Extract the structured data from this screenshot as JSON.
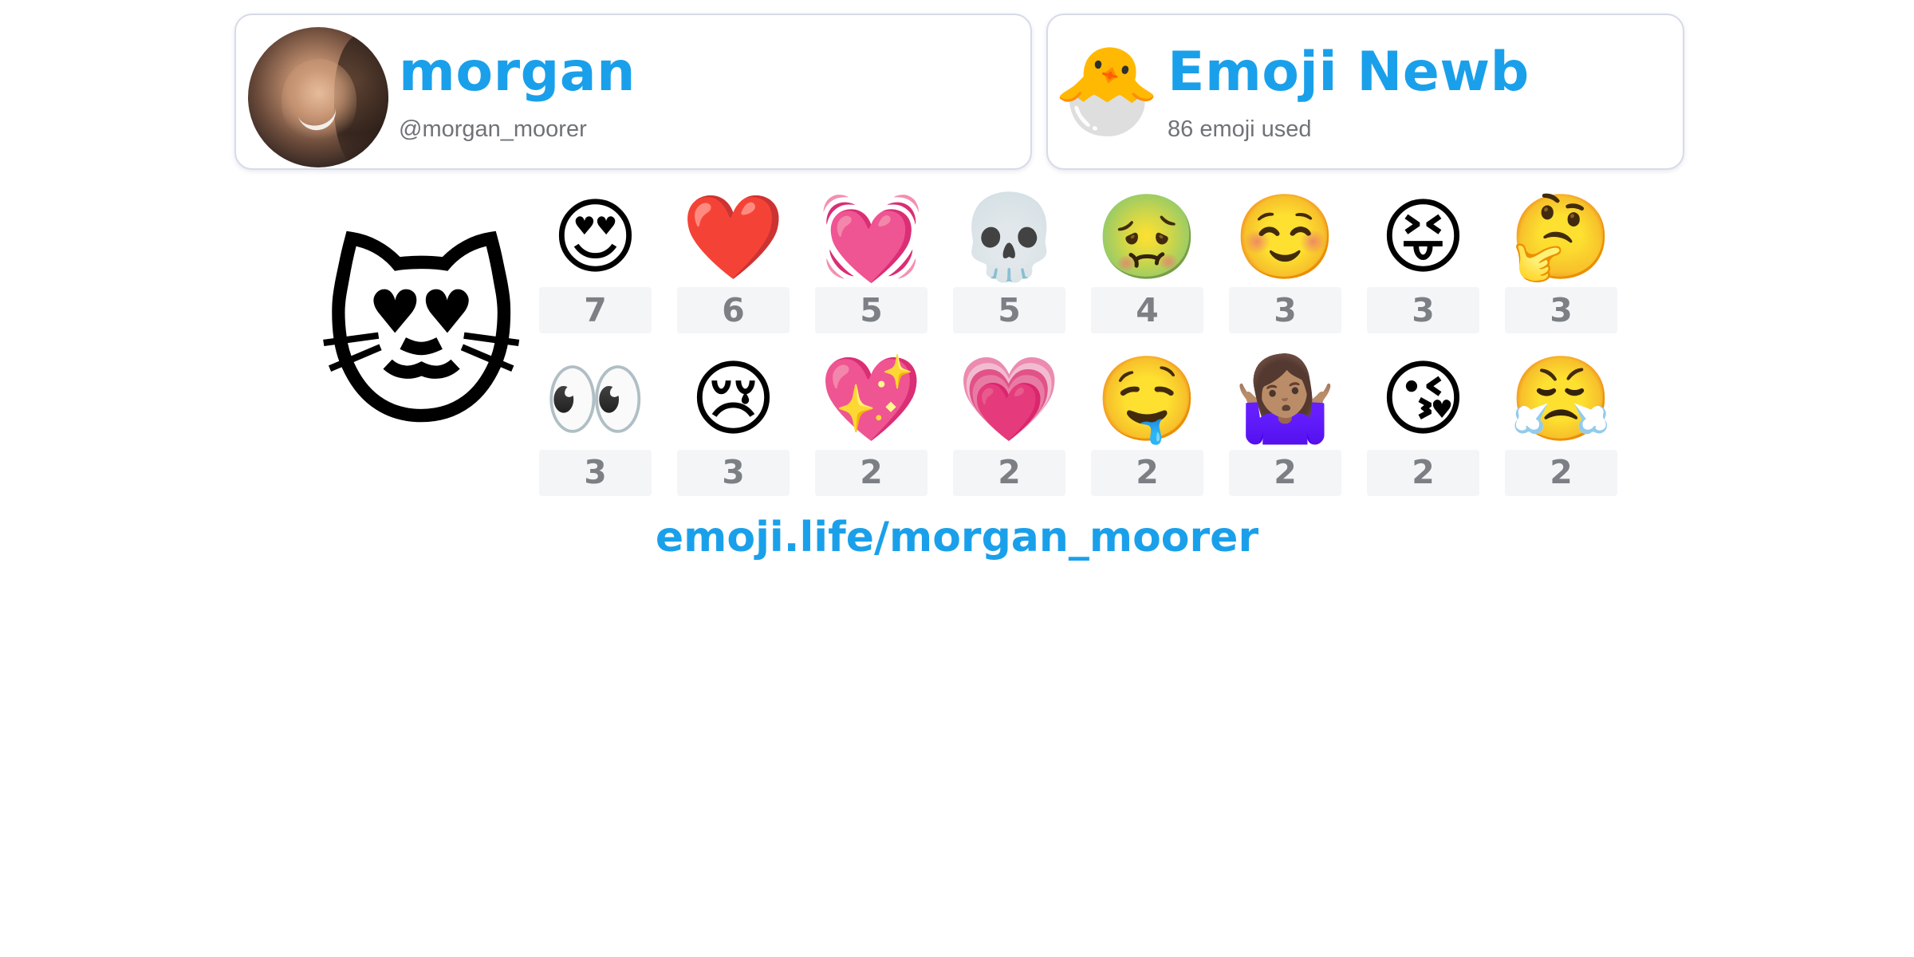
{
  "profile": {
    "name": "morgan",
    "handle": "@morgan_moorer"
  },
  "level": {
    "name": "Emoji Newb",
    "stats": "86 emoji used",
    "icon": "🐣"
  },
  "hero_emoji": "😻",
  "emoji_grid": [
    {
      "emoji": "😍",
      "count": "7",
      "icon_name": "heart-eyes-icon"
    },
    {
      "emoji": "❤️",
      "count": "6",
      "icon_name": "red-heart-icon"
    },
    {
      "emoji": "💓",
      "count": "5",
      "icon_name": "beating-heart-icon"
    },
    {
      "emoji": "💀",
      "count": "5",
      "icon_name": "skull-icon"
    },
    {
      "emoji": "🤢",
      "count": "4",
      "icon_name": "nauseated-face-icon"
    },
    {
      "emoji": "☺️",
      "count": "3",
      "icon_name": "smiling-face-icon"
    },
    {
      "emoji": "😝",
      "count": "3",
      "icon_name": "squinting-tongue-icon"
    },
    {
      "emoji": "🤔",
      "count": "3",
      "icon_name": "thinking-face-icon"
    },
    {
      "emoji": "👀",
      "count": "3",
      "icon_name": "eyes-icon"
    },
    {
      "emoji": "😢",
      "count": "3",
      "icon_name": "crying-face-icon"
    },
    {
      "emoji": "💖",
      "count": "2",
      "icon_name": "sparkling-heart-icon"
    },
    {
      "emoji": "💗",
      "count": "2",
      "icon_name": "growing-heart-icon"
    },
    {
      "emoji": "🤤",
      "count": "2",
      "icon_name": "drooling-face-icon"
    },
    {
      "emoji": "🤷🏽‍♀️",
      "count": "2",
      "icon_name": "shrug-icon"
    },
    {
      "emoji": "😘",
      "count": "2",
      "icon_name": "kiss-face-icon"
    },
    {
      "emoji": "😤",
      "count": "2",
      "icon_name": "steam-face-icon"
    }
  ],
  "link": "emoji.life/morgan_moorer",
  "colors": {
    "accent": "#1aa0ea",
    "text_muted": "#6f7378",
    "tile_bg": "#f4f5f7",
    "card_border": "#d6dbe8"
  }
}
